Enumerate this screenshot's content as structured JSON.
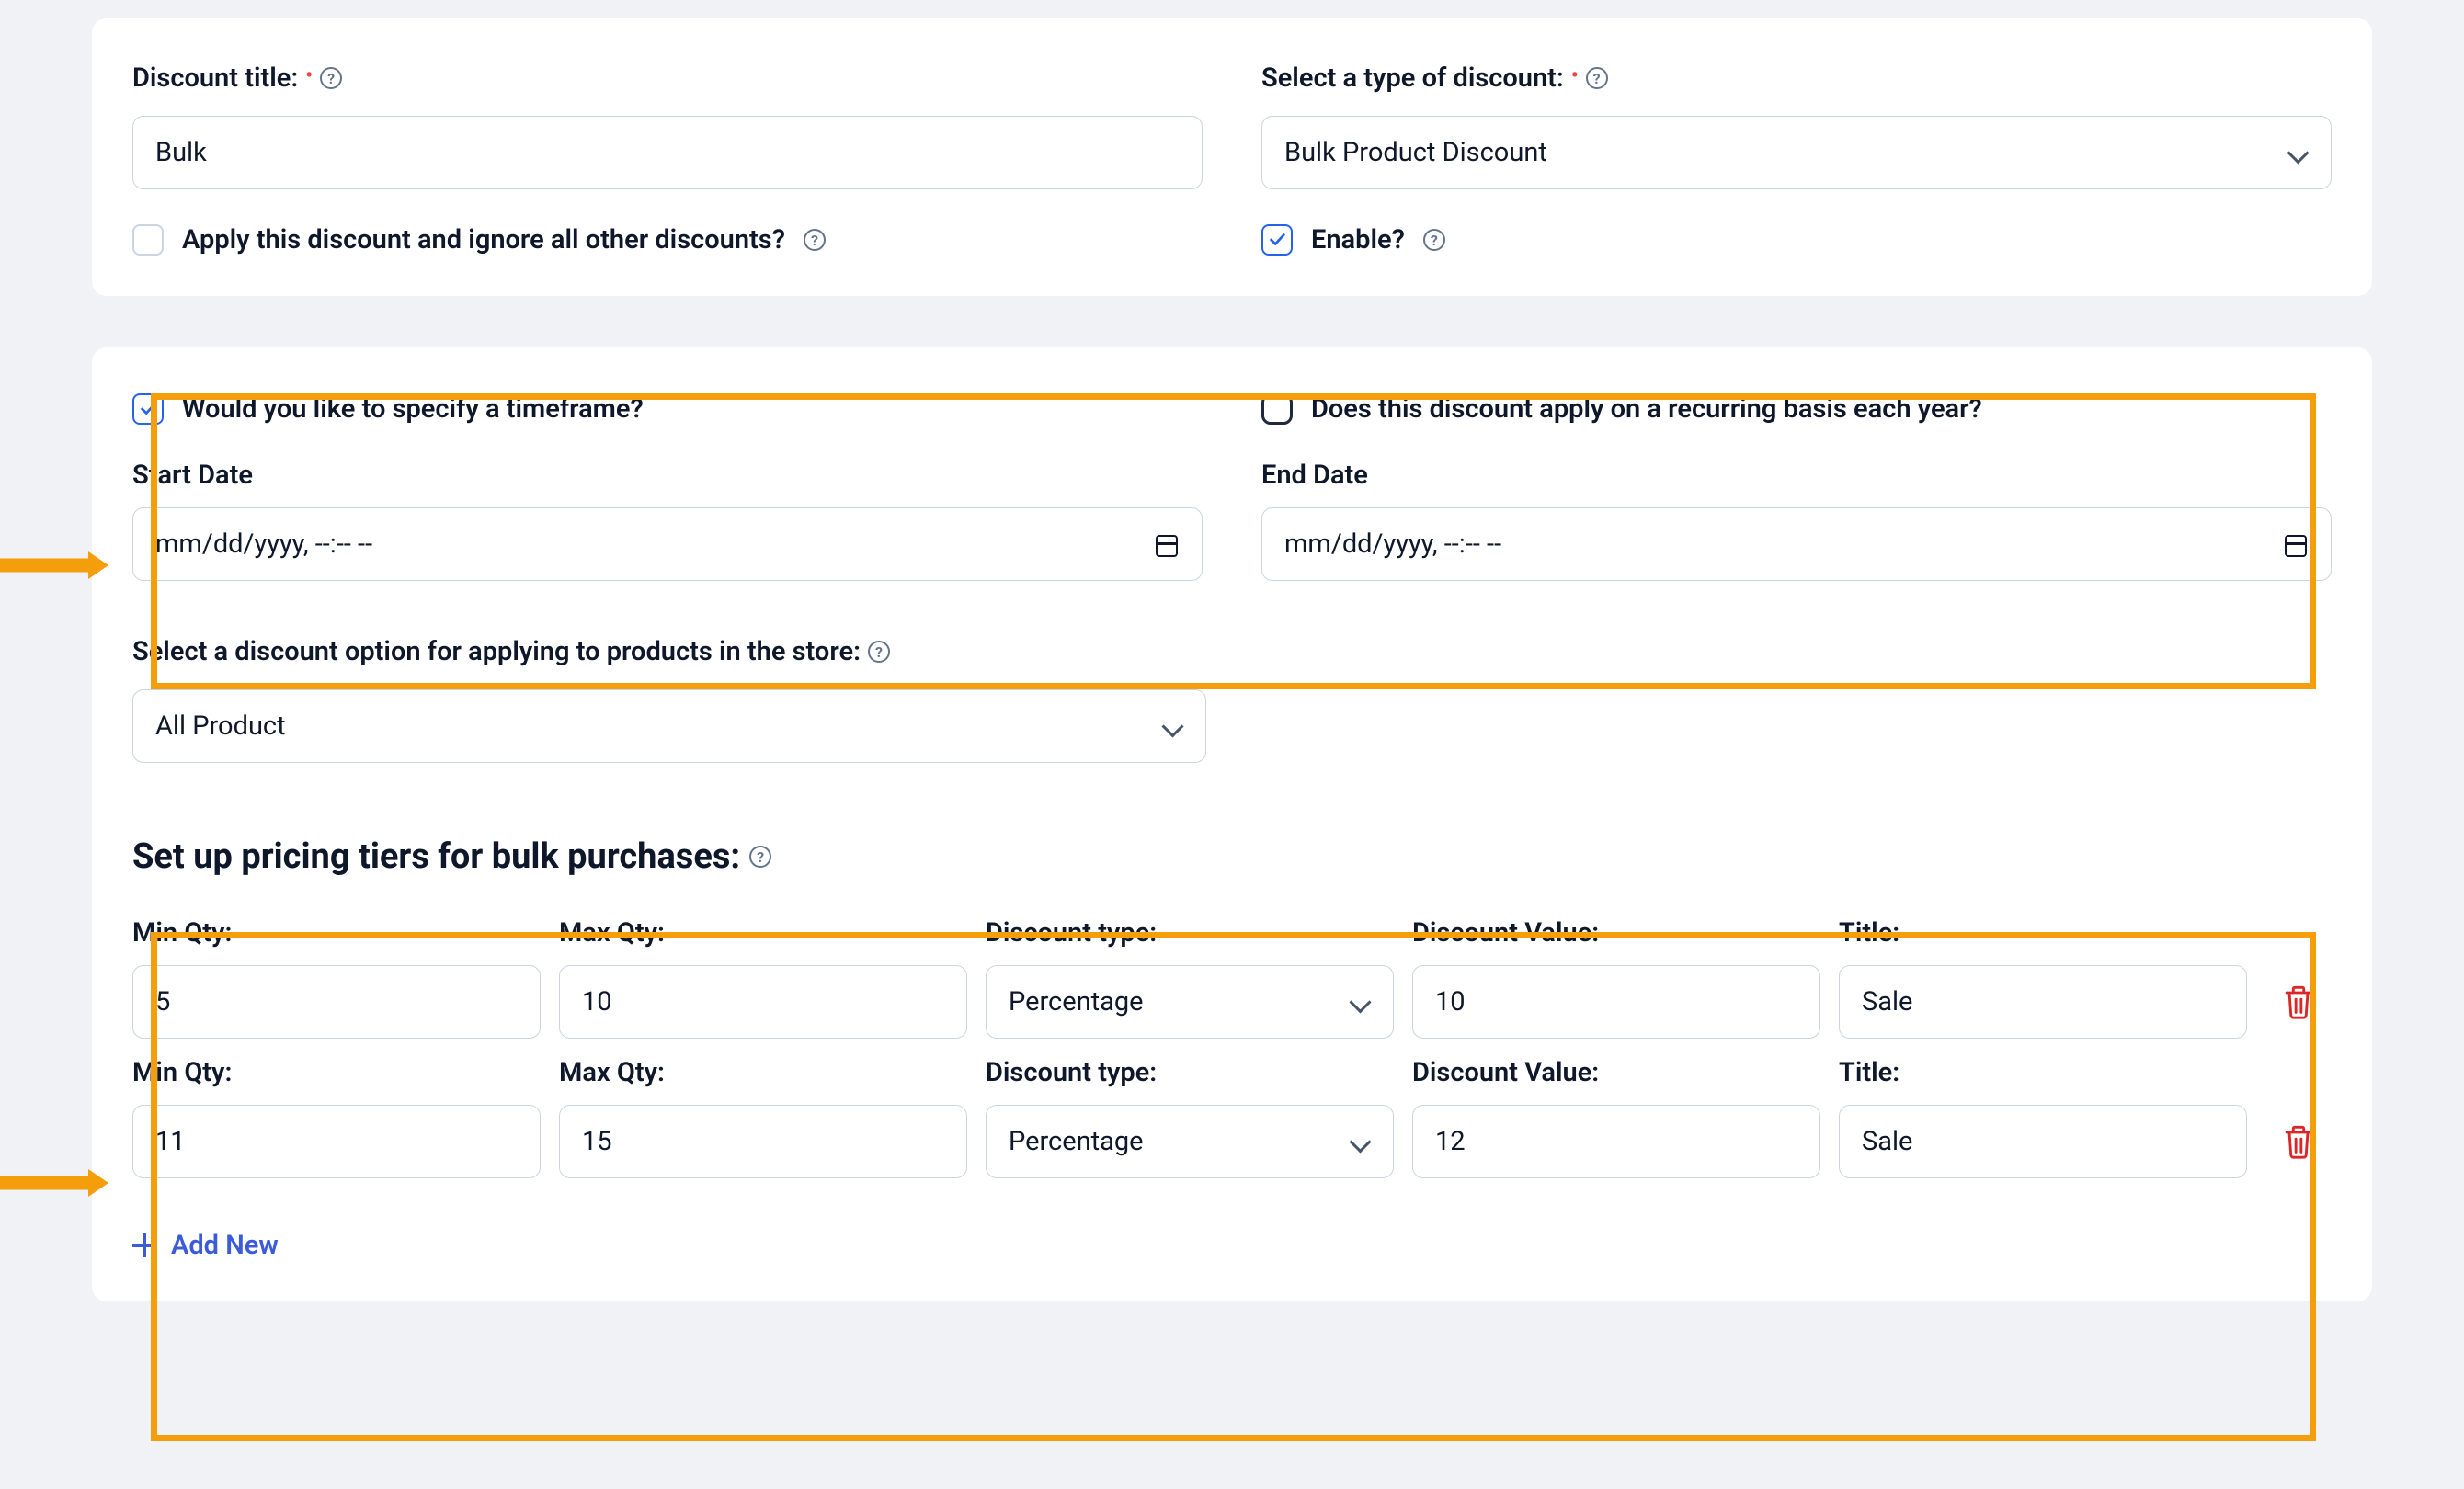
{
  "card1": {
    "title_label": "Discount title:",
    "title_value": "Bulk",
    "type_label": "Select a type of discount:",
    "type_value": "Bulk Product Discount",
    "ignore_label": "Apply this discount and ignore all other discounts?",
    "ignore_checked": false,
    "enable_label": "Enable?",
    "enable_checked": true
  },
  "timeframe": {
    "specify_label": "Would you like to specify a timeframe?",
    "specify_checked": true,
    "recurring_label": "Does this discount apply on a recurring basis each year?",
    "recurring_checked": false,
    "start_label": "Start Date",
    "start_placeholder": "mm/dd/yyyy, --:-- --",
    "end_label": "End Date",
    "end_placeholder": "mm/dd/yyyy, --:-- --"
  },
  "discount_option": {
    "label": "Select a discount option for applying to products in the store:",
    "value": "All Product"
  },
  "tiers": {
    "heading": "Set up pricing tiers for bulk purchases:",
    "headers": {
      "min": "Min Qty:",
      "max": "Max Qty:",
      "type": "Discount type:",
      "value": "Discount Value:",
      "title": "Title:"
    },
    "rows": [
      {
        "min": "5",
        "max": "10",
        "type": "Percentage",
        "value": "10",
        "title": "Sale"
      },
      {
        "min": "11",
        "max": "15",
        "type": "Percentage",
        "value": "12",
        "title": "Sale"
      }
    ],
    "add_new": "Add New"
  }
}
